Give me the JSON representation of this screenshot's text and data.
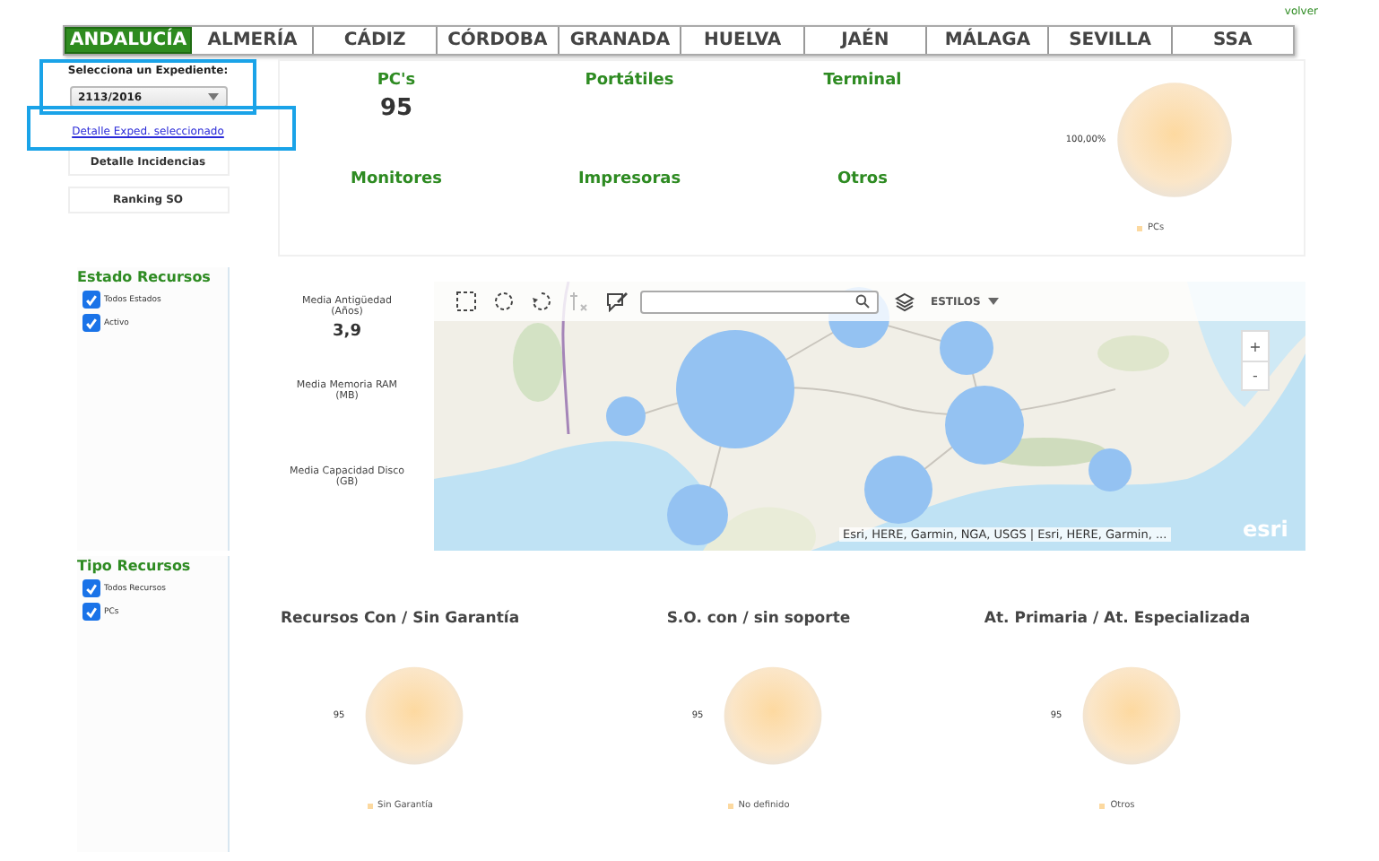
{
  "back_link": "volver",
  "tabs": [
    {
      "label": "ANDALUCÍA",
      "selected": true
    },
    {
      "label": "ALMERÍA",
      "selected": false
    },
    {
      "label": "CÁDIZ",
      "selected": false
    },
    {
      "label": "CÓRDOBA",
      "selected": false
    },
    {
      "label": "GRANADA",
      "selected": false
    },
    {
      "label": "HUELVA",
      "selected": false
    },
    {
      "label": "JAÉN",
      "selected": false
    },
    {
      "label": "MÁLAGA",
      "selected": false
    },
    {
      "label": "SEVILLA",
      "selected": false
    },
    {
      "label": "SSA",
      "selected": false
    }
  ],
  "expediente": {
    "label": "Selecciona un Expediente:",
    "value": "2113/2016"
  },
  "detail_link": "Detalle Exped. seleccionado",
  "buttons": [
    "Detalle Incidencias",
    "Ranking SO"
  ],
  "kpis": [
    {
      "label": "PC's",
      "value": "95"
    },
    {
      "label": "Portátiles"
    },
    {
      "label": "Terminal"
    },
    {
      "label": "Monitores"
    },
    {
      "label": "Impresoras"
    },
    {
      "label": "Otros"
    }
  ],
  "kpi_chart": {
    "chart_data": {
      "type": "pie",
      "categories": [
        "PCs"
      ],
      "values": [
        100
      ],
      "value_labels": [
        "100,00%"
      ]
    }
  },
  "estado_recursos": {
    "title": "Estado Recursos",
    "options": [
      {
        "label": "Todos Estados",
        "checked": true
      },
      {
        "label": "Activo",
        "checked": true
      }
    ]
  },
  "stats": [
    {
      "label": "Media Antigüedad",
      "unit": "(Años)",
      "value": "3,9"
    },
    {
      "label": "Media Memoria RAM",
      "unit": "(MB)"
    },
    {
      "label": "Media Capacidad Disco",
      "unit": "(GB)"
    }
  ],
  "map": {
    "styles_label": "ESTILOS",
    "zoom_buttons": [
      "+",
      "-"
    ],
    "attribution": "Esri, HERE, Garmin, NGA, USGS | Esri, HERE, Garmin, ...",
    "logo": "esri"
  },
  "tipo_recursos": {
    "title": "Tipo Recursos",
    "options": [
      {
        "label": "Todos Recursos",
        "checked": true
      },
      {
        "label": "PCs",
        "checked": true
      }
    ]
  },
  "charts": [
    {
      "title": "Recursos Con / Sin Garantía",
      "chart_data": {
        "type": "pie",
        "categories": [
          "Sin Garantía"
        ],
        "values": [
          95
        ],
        "data_labels": true
      }
    },
    {
      "title": "S.O. con / sin soporte",
      "chart_data": {
        "type": "pie",
        "categories": [
          "No definido"
        ],
        "values": [
          95
        ],
        "data_labels": true
      }
    },
    {
      "title": "At. Primaria / At. Especializada",
      "chart_data": {
        "type": "pie",
        "categories": [
          "Otros"
        ],
        "values": [
          95
        ],
        "data_labels": true
      }
    }
  ]
}
